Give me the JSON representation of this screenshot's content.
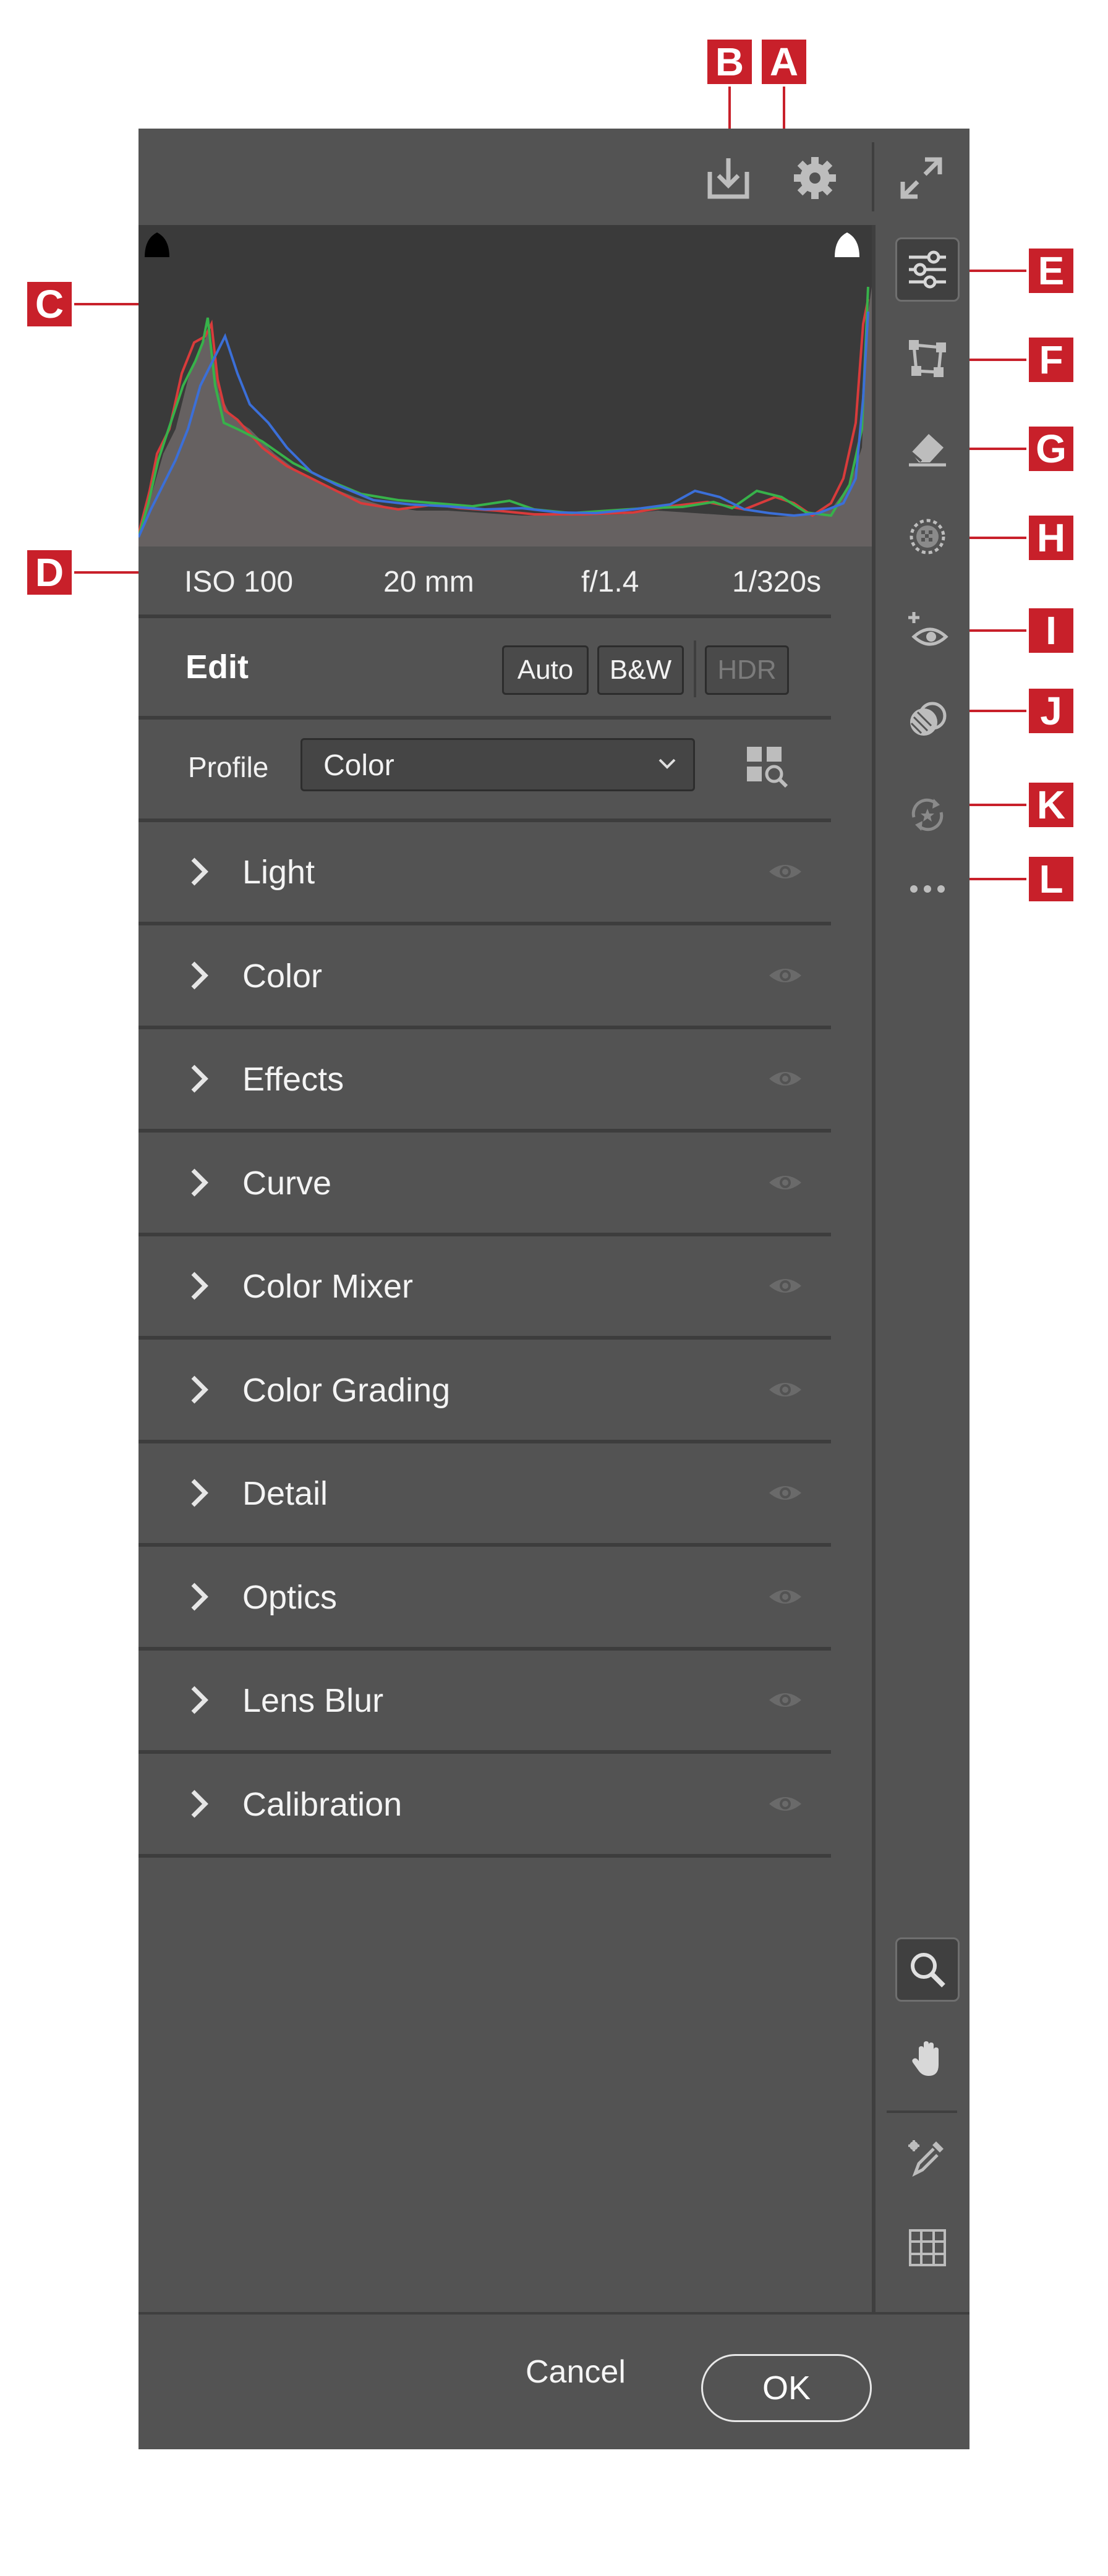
{
  "callouts": {
    "a": "A",
    "b": "B",
    "c": "C",
    "d": "D",
    "e": "E",
    "f": "F",
    "g": "G",
    "h": "H",
    "i": "I",
    "j": "J",
    "k": "K",
    "l": "L"
  },
  "toolbar": {
    "save_icon": "save-download-icon",
    "settings_icon": "gear-icon",
    "fullscreen_icon": "expand-icon"
  },
  "exif": {
    "iso": "ISO 100",
    "focal_length": "20 mm",
    "aperture": "f/1.4",
    "shutter": "1/320s"
  },
  "edit": {
    "title": "Edit",
    "auto_label": "Auto",
    "bw_label": "B&W",
    "hdr_label": "HDR"
  },
  "profile": {
    "label": "Profile",
    "value": "Color"
  },
  "sections": [
    {
      "label": "Light"
    },
    {
      "label": "Color"
    },
    {
      "label": "Effects"
    },
    {
      "label": "Curve"
    },
    {
      "label": "Color Mixer"
    },
    {
      "label": "Color Grading"
    },
    {
      "label": "Detail"
    },
    {
      "label": "Optics"
    },
    {
      "label": "Lens Blur"
    },
    {
      "label": "Calibration"
    }
  ],
  "sidebar_tools": [
    {
      "icon": "sliders-edit-icon",
      "active": true
    },
    {
      "icon": "crop-transform-icon"
    },
    {
      "icon": "eraser-remove-icon"
    },
    {
      "icon": "masking-icon"
    },
    {
      "icon": "red-eye-icon"
    },
    {
      "icon": "presets-icon"
    },
    {
      "icon": "snapshots-icon"
    },
    {
      "icon": "more-options-icon"
    }
  ],
  "bottom_tools": [
    {
      "icon": "zoom-icon",
      "active": true
    },
    {
      "icon": "hand-icon"
    },
    {
      "icon": "color-sampler-icon"
    },
    {
      "icon": "grid-overlay-icon"
    }
  ],
  "footer": {
    "cancel_label": "Cancel",
    "ok_label": "OK"
  },
  "colors": {
    "panel_bg": "#535353",
    "histogram_bg": "#3a3a3a",
    "callout_red": "#c8202a"
  }
}
